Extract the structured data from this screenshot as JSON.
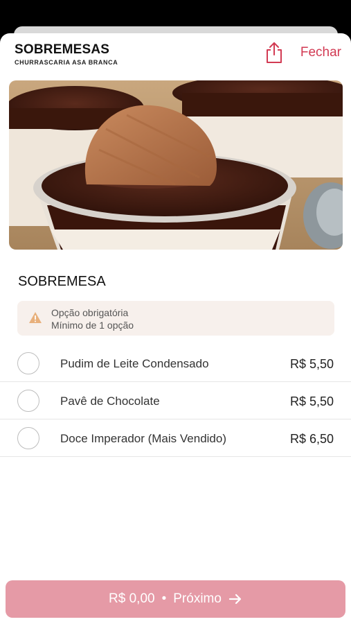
{
  "header": {
    "title": "SOBREMESAS",
    "subtitle": "CHURRASCARIA ASA BRANCA",
    "close_label": "Fechar",
    "share_icon": "share-icon"
  },
  "hero_image": {
    "description_icon": "dessert-photo"
  },
  "section": {
    "title": "SOBREMESA",
    "notice_line1": "Opção obrigatória",
    "notice_line2": "Mínimo de 1 opção",
    "notice_icon": "warning-icon"
  },
  "options": [
    {
      "name": "Pudim de Leite Condensado",
      "price": "R$ 5,50",
      "selected": false
    },
    {
      "name": "Pavê de Chocolate",
      "price": "R$ 5,50",
      "selected": false
    },
    {
      "name": "Doce Imperador (Mais Vendido)",
      "price": "R$ 6,50",
      "selected": false
    }
  ],
  "footer": {
    "total": "R$ 0,00",
    "separator": "•",
    "next_label": "Próximo",
    "arrow_icon": "arrow-right-icon"
  },
  "colors": {
    "accent": "#d23a53",
    "button_bg": "#e59aa6",
    "notice_bg": "#f7f0ec",
    "warning": "#e8b07c"
  }
}
